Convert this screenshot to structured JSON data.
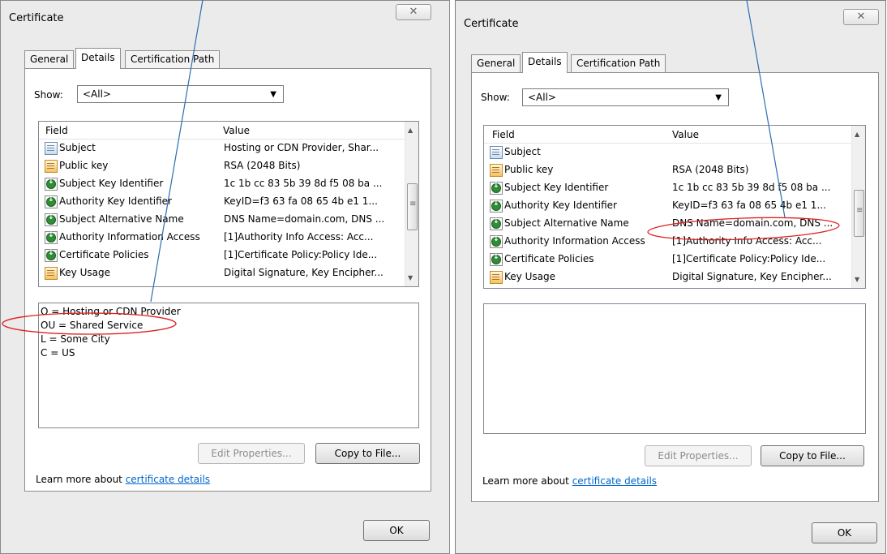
{
  "dialogs": [
    {
      "title": "Certificate",
      "close_glyph": "✕",
      "tabs": [
        "General",
        "Details",
        "Certification Path"
      ],
      "show_label": "Show:",
      "show_value": "<All>",
      "columns": [
        "Field",
        "Value"
      ],
      "rows": [
        {
          "field": "Subject",
          "value": "Hosting or CDN Provider, Shar...",
          "icon": "doc-icon"
        },
        {
          "field": "Public key",
          "value": "RSA (2048 Bits)",
          "icon": "key-icon"
        },
        {
          "field": "Subject Key Identifier",
          "value": "1c 1b cc 83 5b 39 8d f5 08 ba ...",
          "icon": "extension-icon"
        },
        {
          "field": "Authority Key Identifier",
          "value": "KeyID=f3 63 fa 08 65 4b e1 1...",
          "icon": "extension-icon"
        },
        {
          "field": "Subject Alternative Name",
          "value": "DNS Name=domain.com, DNS ...",
          "icon": "extension-icon"
        },
        {
          "field": "Authority Information Access",
          "value": "[1]Authority Info Access: Acc...",
          "icon": "extension-icon"
        },
        {
          "field": "Certificate Policies",
          "value": "[1]Certificate Policy:Policy Ide...",
          "icon": "extension-icon"
        },
        {
          "field": "Key Usage",
          "value": "Digital Signature, Key Encipher...",
          "icon": "key-icon"
        }
      ],
      "detail_lines": [
        "O = Hosting or CDN Provider",
        "OU = Shared Service",
        "L = Some City",
        "C = US"
      ],
      "edit_button": "Edit Properties...",
      "copy_button": "Copy to File...",
      "learn_prefix": "Learn more about ",
      "learn_link": "certificate details",
      "ok_button": "OK"
    },
    {
      "title": "Certificate",
      "close_glyph": "✕",
      "tabs": [
        "General",
        "Details",
        "Certification Path"
      ],
      "show_label": "Show:",
      "show_value": "<All>",
      "columns": [
        "Field",
        "Value"
      ],
      "rows": [
        {
          "field": "Subject",
          "value": "",
          "icon": "doc-icon"
        },
        {
          "field": "Public key",
          "value": "RSA (2048 Bits)",
          "icon": "key-icon"
        },
        {
          "field": "Subject Key Identifier",
          "value": "1c 1b cc 83 5b 39 8d f5 08 ba ...",
          "icon": "extension-icon"
        },
        {
          "field": "Authority Key Identifier",
          "value": "KeyID=f3 63 fa 08 65 4b e1 1...",
          "icon": "extension-icon"
        },
        {
          "field": "Subject Alternative Name",
          "value": "DNS Name=domain.com, DNS ...",
          "icon": "extension-icon"
        },
        {
          "field": "Authority Information Access",
          "value": "[1]Authority Info Access: Acc...",
          "icon": "extension-icon"
        },
        {
          "field": "Certificate Policies",
          "value": "[1]Certificate Policy:Policy Ide...",
          "icon": "extension-icon"
        },
        {
          "field": "Key Usage",
          "value": "Digital Signature, Key Encipher...",
          "icon": "key-icon"
        }
      ],
      "detail_lines": [],
      "edit_button": "Edit Properties...",
      "copy_button": "Copy to File...",
      "learn_prefix": "Learn more about ",
      "learn_link": "certificate details",
      "ok_button": "OK"
    }
  ],
  "colors": {
    "annotation_line": "#2e6db0",
    "annotation_ellipse": "#e02020",
    "link": "#0066cc"
  },
  "scroll_glyphs": {
    "up": "▲",
    "down": "▼",
    "dropdown": "▼"
  }
}
